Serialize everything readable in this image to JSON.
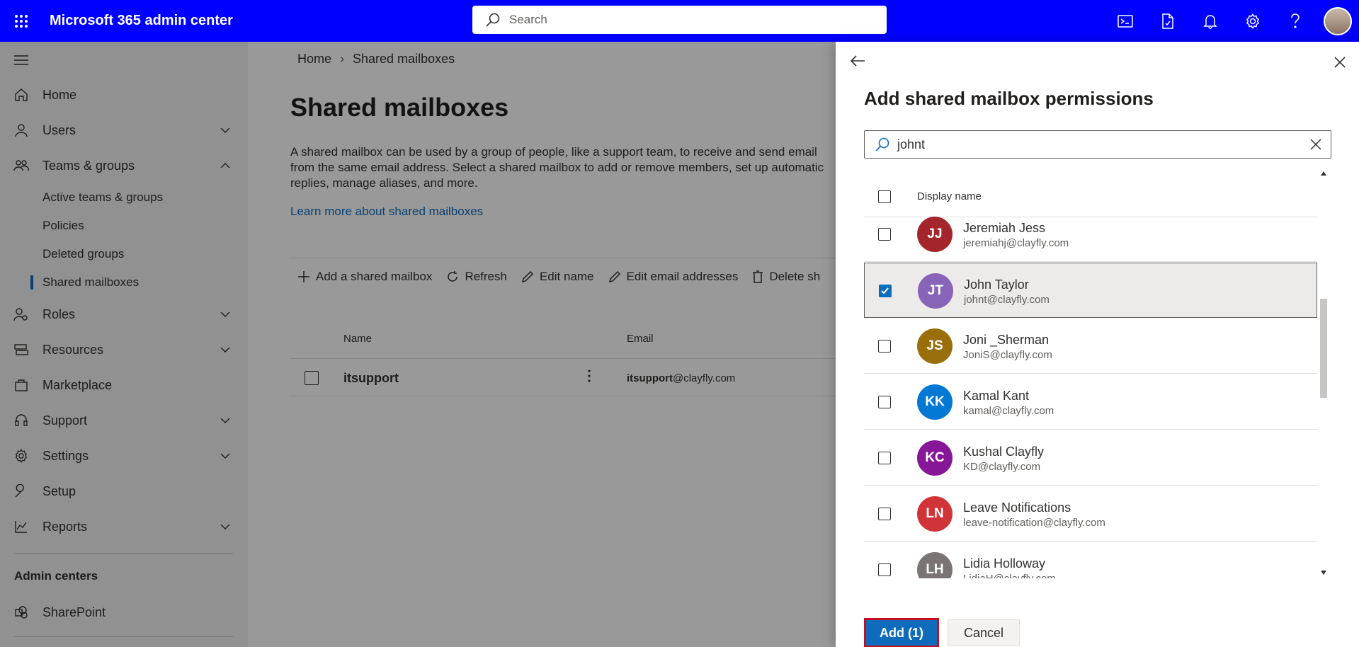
{
  "header": {
    "app_title": "Microsoft 365 admin center",
    "search_placeholder": "Search"
  },
  "sidebar": {
    "items": [
      {
        "label": "Home",
        "icon": "home-icon"
      },
      {
        "label": "Users",
        "icon": "person-icon"
      },
      {
        "label": "Teams & groups",
        "icon": "people-icon"
      },
      {
        "label": "Roles",
        "icon": "roles-icon"
      },
      {
        "label": "Resources",
        "icon": "resources-icon"
      },
      {
        "label": "Marketplace",
        "icon": "marketplace-icon"
      },
      {
        "label": "Support",
        "icon": "headset-icon"
      },
      {
        "label": "Settings",
        "icon": "gear-icon"
      },
      {
        "label": "Setup",
        "icon": "wrench-icon"
      },
      {
        "label": "Reports",
        "icon": "chart-icon"
      }
    ],
    "subitems": [
      "Active teams & groups",
      "Policies",
      "Deleted groups",
      "Shared mailboxes"
    ],
    "admin_centers_label": "Admin centers",
    "sharepoint_label": "SharePoint"
  },
  "main": {
    "breadcrumb": [
      "Home",
      "Shared mailboxes"
    ],
    "title": "Shared mailboxes",
    "description": "A shared mailbox can be used by a group of people, like a support team, to receive and send email from the same email address. Select a shared mailbox to add or remove members, set up automatic replies, manage aliases, and more.",
    "learn_more": "Learn more about shared mailboxes",
    "toolbar": {
      "add": "Add a shared mailbox",
      "refresh": "Refresh",
      "edit_name": "Edit name",
      "edit_email": "Edit email addresses",
      "delete": "Delete sh"
    },
    "table": {
      "headers": [
        "Name",
        "Email"
      ],
      "rows": [
        {
          "name": "itsupport",
          "email_bold": "itsupport",
          "email_domain": "@clayfly.com"
        }
      ]
    }
  },
  "panel": {
    "title": "Add shared mailbox permissions",
    "search_value": "johnt",
    "column_header": "Display name",
    "users": [
      {
        "initials": "JJ",
        "name": "Jeremiah Jess",
        "email": "jeremiahj@clayfly.com",
        "color": "#a4262c",
        "checked": false
      },
      {
        "initials": "JT",
        "name": "John Taylor",
        "email": "johnt@clayfly.com",
        "color": "#8764b8",
        "checked": true
      },
      {
        "initials": "JS",
        "name": "Joni _Sherman",
        "email": "JoniS@clayfly.com",
        "color": "#986f0b",
        "checked": false
      },
      {
        "initials": "KK",
        "name": "Kamal Kant",
        "email": "kamal@clayfly.com",
        "color": "#0078d4",
        "checked": false
      },
      {
        "initials": "KC",
        "name": "Kushal Clayfly",
        "email": "KD@clayfly.com",
        "color": "#881798",
        "checked": false
      },
      {
        "initials": "LN",
        "name": "Leave Notifications",
        "email": "leave-notification@clayfly.com",
        "color": "#d13438",
        "checked": false
      },
      {
        "initials": "LH",
        "name": "Lidia Holloway",
        "email": "LidiaH@clayfly.com",
        "color": "#7a7574",
        "checked": false
      }
    ],
    "add_label": "Add (1)",
    "cancel_label": "Cancel"
  }
}
